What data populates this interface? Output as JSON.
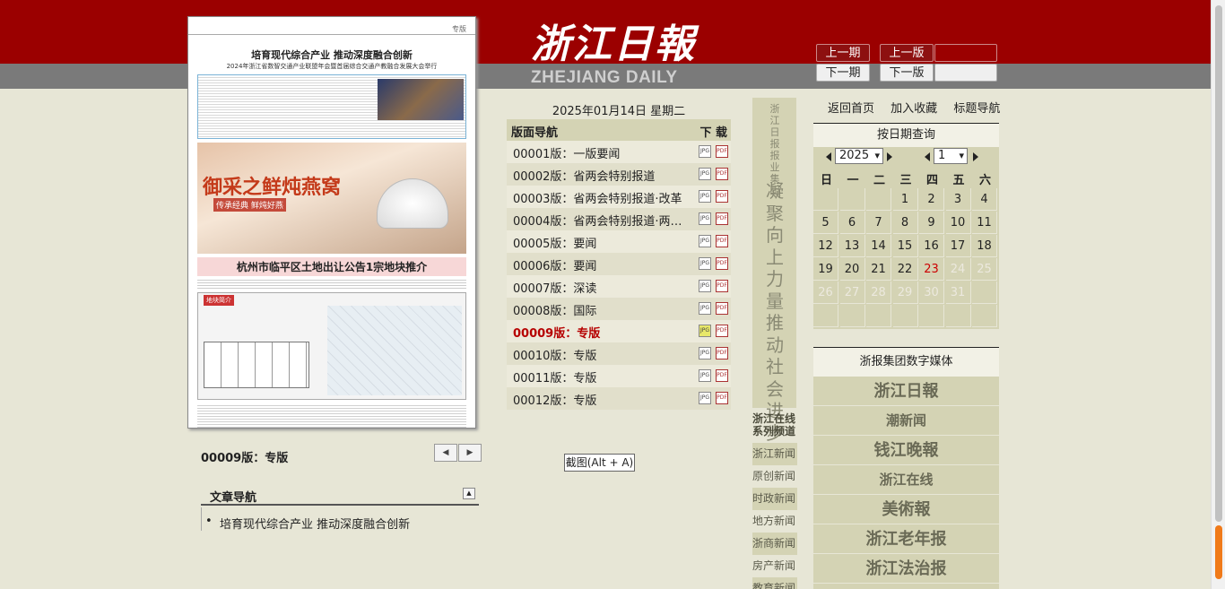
{
  "header": {
    "logo_cn": "浙江日報",
    "logo_en": "ZHEJIANG DAILY",
    "prev_issue": "上一期",
    "prev_page": "上一版",
    "next_issue": "下一期",
    "next_page": "下一版"
  },
  "paper": {
    "mast": "专版",
    "headline1": "培育现代综合产业 推动深度融合创新",
    "subhead1": "2024年浙江省数智交通产业联盟年会暨首届综合交通产教融合发展大会举行",
    "ad_title": "御采之鲜炖燕窝",
    "ad_sub": "传承经典 鲜炖好燕",
    "headline2": "杭州市临平区土地出让公告1宗地块推介",
    "map_tag": "地块简介"
  },
  "current_page": "00009版：专版",
  "pager": {
    "prev": "◀",
    "next": "▶"
  },
  "article_nav": {
    "title": "文章导航",
    "collapse": "▲",
    "items": [
      "培育现代综合产业 推动深度融合创新"
    ]
  },
  "date_line": "2025年01月14日 星期二",
  "page_nav": {
    "title": "版面导航",
    "download": "下 载",
    "jpg_label": "JPG",
    "pdf_label": "PDF",
    "pages": [
      "00001版：一版要闻",
      "00002版：省两会特别报道",
      "00003版：省两会特别报道·改革",
      "00004版：省两会特别报道·两会...",
      "00005版：要闻",
      "00006版：要闻",
      "00007版：深读",
      "00008版：国际",
      "00009版：专版",
      "00010版：专版",
      "00011版：专版",
      "00012版：专版"
    ],
    "active_index": 8
  },
  "tooltip": "截图(Alt + A)",
  "slogan": {
    "small": "浙江日报报业集团",
    "big": "凝聚向上力量推动社会进步"
  },
  "channels": {
    "title": "浙江在线系列频道",
    "items": [
      "浙江新闻",
      "原创新闻",
      "时政新闻",
      "地方新闻",
      "浙商新闻",
      "房产新闻",
      "教育新闻"
    ]
  },
  "links": [
    "返回首页",
    "加入收藏",
    "标题导航"
  ],
  "calendar": {
    "title": "按日期查询",
    "year": "2025",
    "month": "1",
    "weekdays": [
      "日",
      "一",
      "二",
      "三",
      "四",
      "五",
      "六"
    ],
    "days": [
      [
        "",
        "",
        "",
        "1",
        "2",
        "3",
        "4"
      ],
      [
        "5",
        "6",
        "7",
        "8",
        "9",
        "10",
        "11"
      ],
      [
        "12",
        "13",
        "14",
        "15",
        "16",
        "17",
        "18"
      ],
      [
        "19",
        "20",
        "21",
        "22",
        "23",
        "24",
        "25"
      ],
      [
        "26",
        "27",
        "28",
        "29",
        "30",
        "31",
        ""
      ],
      [
        "",
        "",
        "",
        "",
        "",
        "",
        ""
      ]
    ],
    "today": "23",
    "future_after": "23"
  },
  "media": {
    "title": "浙报集团数字媒体",
    "items": [
      "浙江日報",
      "潮新闻",
      "钱江晚報",
      "浙江在线",
      "美術報",
      "浙江老年报",
      "浙江法治报"
    ]
  }
}
